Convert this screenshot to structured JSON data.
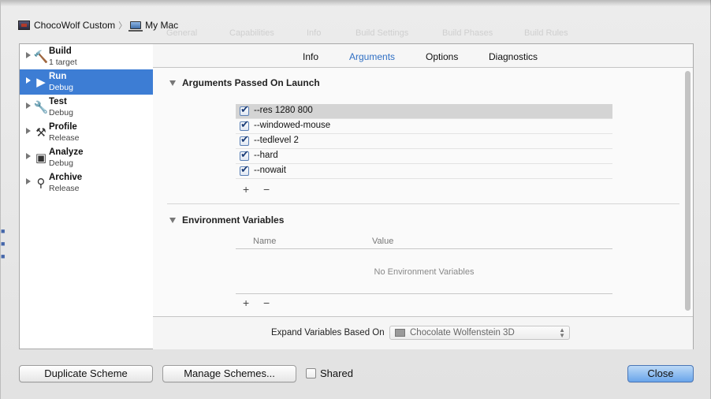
{
  "breadcrumb": {
    "scheme": "ChocoWolf Custom",
    "destination": "My Mac"
  },
  "background_tabs": [
    "General",
    "Capabilities",
    "Info",
    "Build Settings",
    "Build Phases",
    "Build Rules"
  ],
  "actions": [
    {
      "name": "Build",
      "sub": "1 target",
      "icon": "hammer-icon",
      "glyph": "🔨"
    },
    {
      "name": "Run",
      "sub": "Debug",
      "icon": "play-icon",
      "glyph": "▶"
    },
    {
      "name": "Test",
      "sub": "Debug",
      "icon": "wrench-icon",
      "glyph": "🔧"
    },
    {
      "name": "Profile",
      "sub": "Release",
      "icon": "instruments-icon",
      "glyph": "⚒"
    },
    {
      "name": "Analyze",
      "sub": "Debug",
      "icon": "analyze-icon",
      "glyph": "▣"
    },
    {
      "name": "Archive",
      "sub": "Release",
      "icon": "archive-icon",
      "glyph": "⚲"
    }
  ],
  "selected_action": "Run",
  "tabs": [
    "Info",
    "Arguments",
    "Options",
    "Diagnostics"
  ],
  "active_tab": "Arguments",
  "arguments_section": {
    "title": "Arguments Passed On Launch",
    "items": [
      {
        "text": "--res 1280 800",
        "checked": true
      },
      {
        "text": "--windowed-mouse",
        "checked": true
      },
      {
        "text": "--tedlevel 2",
        "checked": true
      },
      {
        "text": "--hard",
        "checked": true
      },
      {
        "text": "--nowait",
        "checked": true
      }
    ],
    "add": "+",
    "remove": "−"
  },
  "env_section": {
    "title": "Environment Variables",
    "col_name": "Name",
    "col_value": "Value",
    "empty": "No Environment Variables",
    "add": "+",
    "remove": "−"
  },
  "expand": {
    "label": "Expand Variables Based On",
    "value": "Chocolate Wolfenstein 3D"
  },
  "buttons": {
    "duplicate": "Duplicate Scheme",
    "manage": "Manage Schemes...",
    "shared": "Shared",
    "close": "Close"
  },
  "colors": {
    "selection": "#3d7dd4",
    "active_tab": "#2f6fc4",
    "primary_button": "#6aa5ea"
  }
}
